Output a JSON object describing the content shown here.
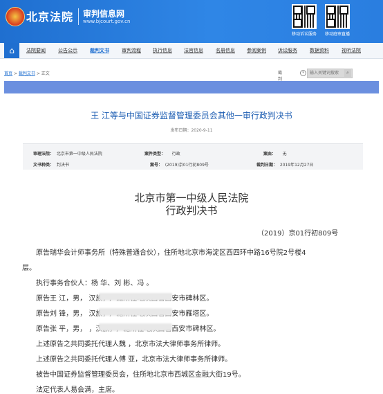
{
  "header": {
    "site_name": "北京法院",
    "sub_title": "审判信息网",
    "sub_url": "www.bjcourt.gov.cn",
    "qr_labels": [
      "移动诉讼服务",
      "移动庭审直播"
    ]
  },
  "nav": {
    "items": [
      "法院要闻",
      "公告公示",
      "裁判文书",
      "审判流程",
      "执行信息",
      "法官信息",
      "名册信息",
      "参阅案例",
      "诉讼服务",
      "数据资料",
      "视听法院"
    ],
    "active_index": 2
  },
  "breadcrumb": {
    "home": "首页",
    "section": "裁判文书",
    "current": "正文",
    "sep": ">"
  },
  "search": {
    "category": "裁判文书",
    "placeholder": "输入关键词搜索"
  },
  "document": {
    "title": "王  江等与中国证券监督管理委员会其他一审行政判决书",
    "publish_date": "发布日期：2020-9-11",
    "meta": {
      "court_label": "审理法院：",
      "court_value": "北京市第一中级人民法院",
      "case_type_label": "案件类型：",
      "case_type_value": "行政",
      "cause_label": "案由：",
      "cause_value": "无",
      "doc_type_label": "文书种类：",
      "doc_type_value": "判决书",
      "case_no_label": "案号：",
      "case_no_value": "(2019)京01行初809号",
      "date_label": "裁判日期：",
      "date_value": "2019年12月27日"
    },
    "court_name": "北京市第一中级人民法院",
    "judgment_type": "行政判决书",
    "case_number": "（2019）京01行初809号",
    "paragraphs": [
      "原告瑞华会计师事务所（特殊普通合伙），住所地北京市海淀区西四环中路16号院2号楼4",
      "层。",
      "执行事务合伙人：杨  华、刘  彬、冯  。",
      "原告王  江，男，                    汉族，户籍所在地陕西省西安市碑林区。",
      "原告刘  锋，男，                    汉族，户籍所在地陕西省西安市雁塔区。",
      "原告张  平，男，                    ，汉族，户籍所在地陕西省西安市碑林区。",
      "上述原告之共同委托代理人魏  ，北京市法大律师事务所律师。",
      "上述原告之共同委托代理人傅  亚，北京市法大律师事务所律师。",
      "被告中国证券监督管理委员会，住所地北京市西城区金融大街19号。",
      "法定代表人易会满，主席。"
    ]
  },
  "colors": {
    "brand": "#1f6fd0",
    "title_blue": "#1f5fb3",
    "banner": "#6b8fdf"
  }
}
